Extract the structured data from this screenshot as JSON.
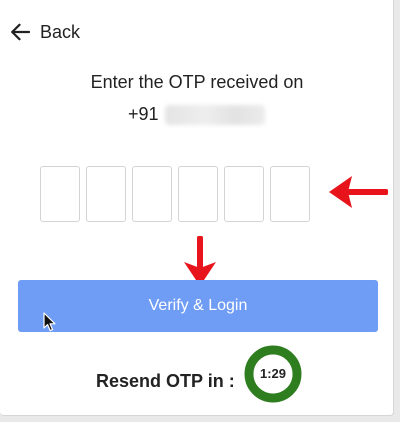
{
  "header": {
    "back_label": "Back"
  },
  "prompt": {
    "text": "Enter the OTP received on",
    "phone_prefix": "+91"
  },
  "otp": {
    "digits": [
      "",
      "",
      "",
      "",
      "",
      ""
    ]
  },
  "verify": {
    "label": "Verify & Login"
  },
  "resend": {
    "label": "Resend OTP in :",
    "timer": "1:29"
  },
  "colors": {
    "button": "#6f9cf4",
    "timer_ring": "#2e7d1f",
    "annotation_arrow": "#e8141c"
  },
  "icons": {
    "back": "arrow-left-icon",
    "annotation": "red-arrow-icon",
    "cursor": "mouse-cursor-icon"
  }
}
